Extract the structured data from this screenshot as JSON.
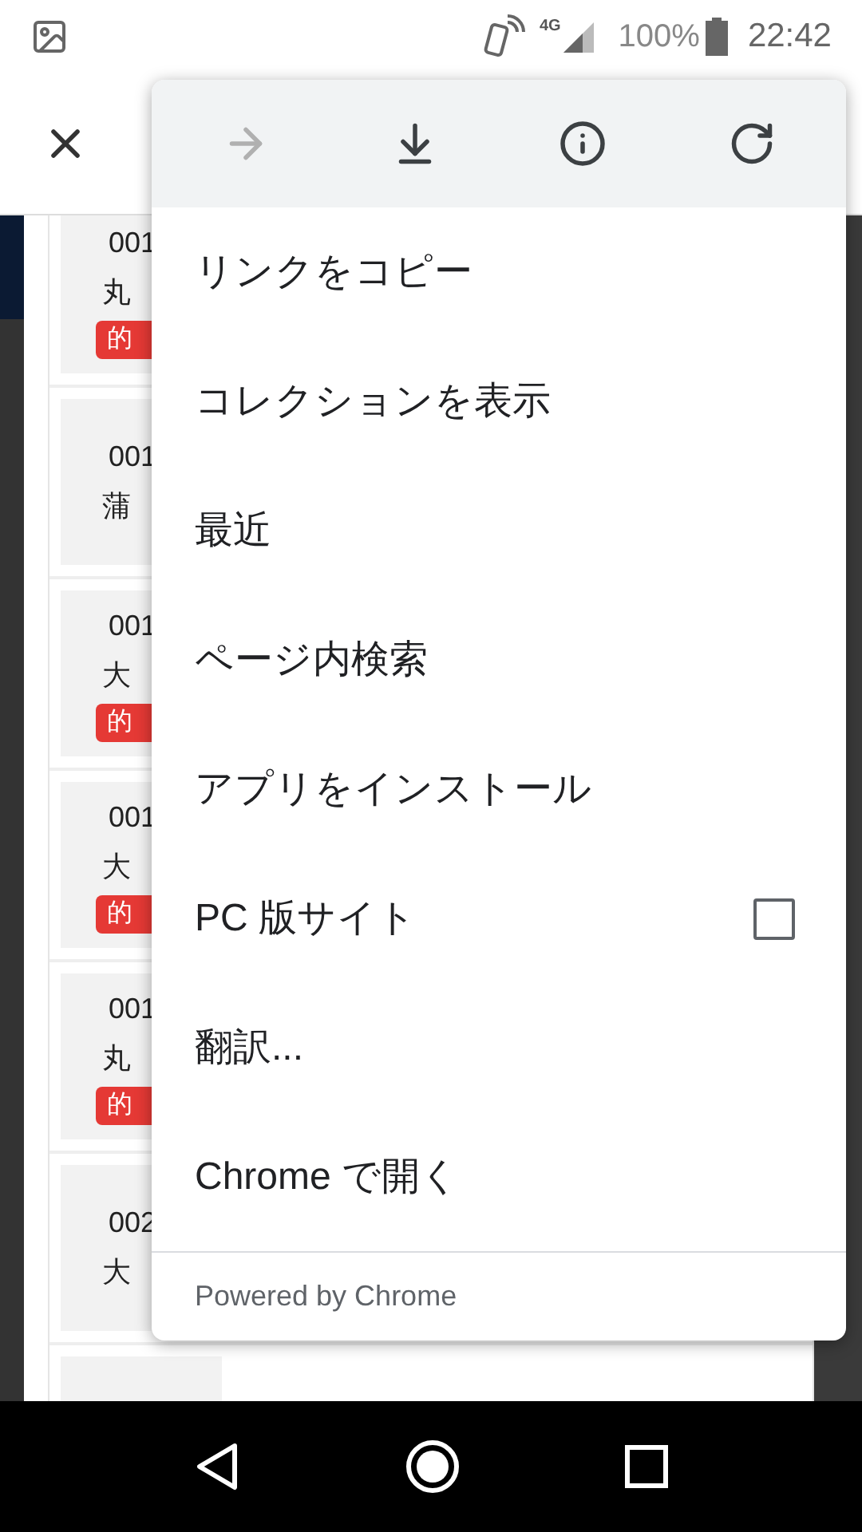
{
  "status_bar": {
    "network": "4G",
    "battery": "100%",
    "time": "22:42"
  },
  "cards": [
    {
      "kind": "item",
      "number": "001",
      "name": "丸",
      "badge": "的"
    },
    {
      "kind": "item",
      "number": "001",
      "name": "蒲"
    },
    {
      "kind": "item",
      "number": "001",
      "name": "大",
      "badge": "的"
    },
    {
      "kind": "item",
      "number": "001",
      "name": "大",
      "badge": "的"
    },
    {
      "kind": "item",
      "number": "001",
      "name": "丸",
      "badge": "的"
    },
    {
      "kind": "item",
      "number": "002",
      "name": "大"
    },
    {
      "kind": "blank"
    }
  ],
  "menu": {
    "actions": [
      {
        "kind": "forward",
        "disabled": true
      },
      {
        "kind": "download",
        "disabled": false
      },
      {
        "kind": "info",
        "disabled": false
      },
      {
        "kind": "reload",
        "disabled": false
      }
    ],
    "items": [
      {
        "label": "リンクをコピー",
        "kind": "plain"
      },
      {
        "label": "コレクションを表示",
        "kind": "plain"
      },
      {
        "label": "最近",
        "kind": "plain"
      },
      {
        "label": "ページ内検索",
        "kind": "plain"
      },
      {
        "label": "アプリをインストール",
        "kind": "plain"
      },
      {
        "label": "PC 版サイト",
        "kind": "checkbox",
        "checked": false
      },
      {
        "label": "翻訳...",
        "kind": "plain"
      },
      {
        "label": "Chrome で開く",
        "kind": "plain"
      }
    ],
    "footer": "Powered by Chrome"
  }
}
